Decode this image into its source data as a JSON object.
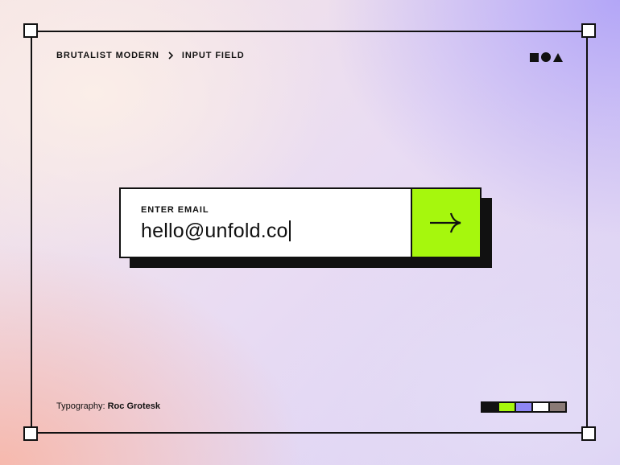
{
  "breadcrumb": {
    "section": "BRUTALIST MODERN",
    "page": "INPUT FIELD"
  },
  "header_shapes": [
    "square-icon",
    "circle-icon",
    "triangle-icon"
  ],
  "input": {
    "label": "ENTER EMAIL",
    "value": "hello@unfold.co",
    "submit_icon": "arrow-right-icon",
    "accent_color": "#a6f70d"
  },
  "footer": {
    "typography_label": "Typography:",
    "typography_font": "Roc Grotesk"
  },
  "palette": [
    "#111111",
    "#a6f70d",
    "#8e86f4",
    "#ffffff",
    "#8a7a76"
  ]
}
